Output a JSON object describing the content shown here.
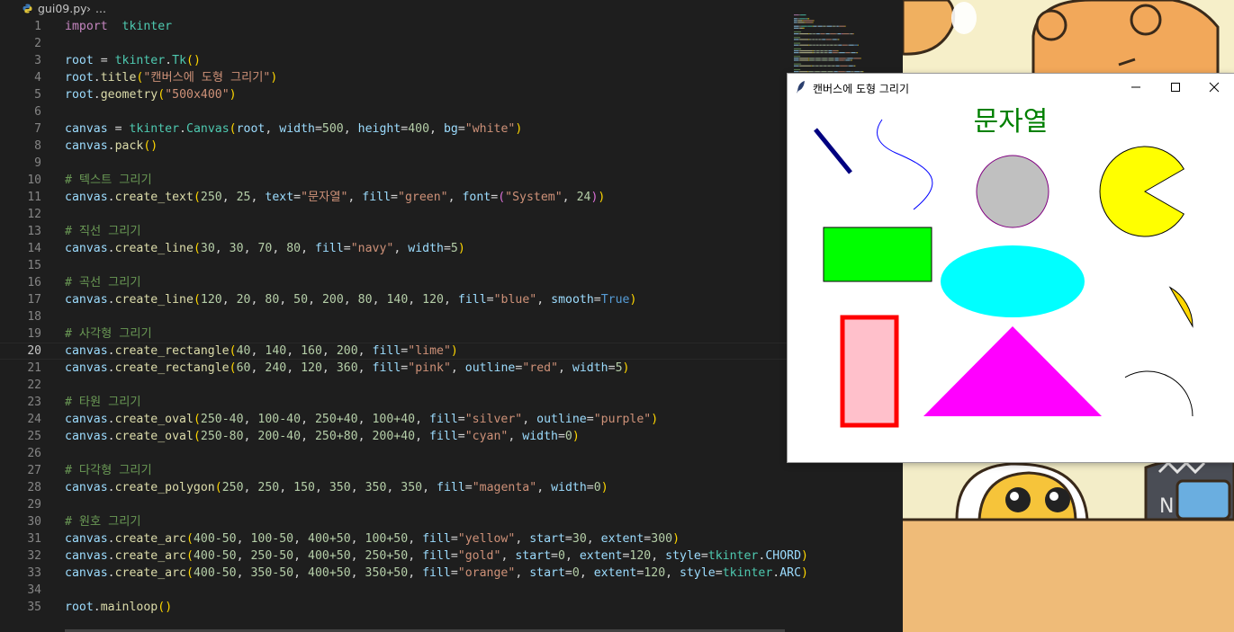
{
  "breadcrumb": {
    "file": "gui09.py",
    "separator": "›",
    "rest": "..."
  },
  "lines": [
    {
      "n": "1",
      "t": [
        [
          "kw",
          "import"
        ],
        [
          "",
          "  "
        ],
        [
          "cls",
          "tkinter"
        ]
      ]
    },
    {
      "n": "2",
      "t": []
    },
    {
      "n": "3",
      "t": [
        [
          "var",
          "root"
        ],
        [
          "",
          " = "
        ],
        [
          "cls",
          "tkinter"
        ],
        [
          "",
          "."
        ],
        [
          "cls",
          "Tk"
        ],
        [
          "p1",
          "()"
        ]
      ]
    },
    {
      "n": "4",
      "t": [
        [
          "var",
          "root"
        ],
        [
          "",
          "."
        ],
        [
          "fn",
          "title"
        ],
        [
          "p1",
          "("
        ],
        [
          "str",
          "\"캔버스에 도형 그리기\""
        ],
        [
          "p1",
          ")"
        ]
      ]
    },
    {
      "n": "5",
      "t": [
        [
          "var",
          "root"
        ],
        [
          "",
          "."
        ],
        [
          "fn",
          "geometry"
        ],
        [
          "p1",
          "("
        ],
        [
          "str",
          "\"500x400\""
        ],
        [
          "p1",
          ")"
        ]
      ]
    },
    {
      "n": "6",
      "t": []
    },
    {
      "n": "7",
      "t": [
        [
          "var",
          "canvas"
        ],
        [
          "",
          " = "
        ],
        [
          "cls",
          "tkinter"
        ],
        [
          "",
          "."
        ],
        [
          "cls",
          "Canvas"
        ],
        [
          "p1",
          "("
        ],
        [
          "var",
          "root"
        ],
        [
          "",
          ", "
        ],
        [
          "var",
          "width"
        ],
        [
          "",
          "="
        ],
        [
          "num",
          "500"
        ],
        [
          "",
          ", "
        ],
        [
          "var",
          "height"
        ],
        [
          "",
          "="
        ],
        [
          "num",
          "400"
        ],
        [
          "",
          ", "
        ],
        [
          "var",
          "bg"
        ],
        [
          "",
          "="
        ],
        [
          "str",
          "\"white\""
        ],
        [
          "p1",
          ")"
        ]
      ]
    },
    {
      "n": "8",
      "t": [
        [
          "var",
          "canvas"
        ],
        [
          "",
          "."
        ],
        [
          "fn",
          "pack"
        ],
        [
          "p1",
          "()"
        ]
      ]
    },
    {
      "n": "9",
      "t": []
    },
    {
      "n": "10",
      "t": [
        [
          "com",
          "# 텍스트 그리기"
        ]
      ]
    },
    {
      "n": "11",
      "t": [
        [
          "var",
          "canvas"
        ],
        [
          "",
          "."
        ],
        [
          "fn",
          "create_text"
        ],
        [
          "p1",
          "("
        ],
        [
          "num",
          "250"
        ],
        [
          "",
          ", "
        ],
        [
          "num",
          "25"
        ],
        [
          "",
          ", "
        ],
        [
          "var",
          "text"
        ],
        [
          "",
          "="
        ],
        [
          "str",
          "\"문자열\""
        ],
        [
          "",
          ", "
        ],
        [
          "var",
          "fill"
        ],
        [
          "",
          "="
        ],
        [
          "str",
          "\"green\""
        ],
        [
          "",
          ", "
        ],
        [
          "var",
          "font"
        ],
        [
          "",
          "="
        ],
        [
          "p2",
          "("
        ],
        [
          "str",
          "\"System\""
        ],
        [
          "",
          ", "
        ],
        [
          "num",
          "24"
        ],
        [
          "p2",
          ")"
        ],
        [
          "p1",
          ")"
        ]
      ]
    },
    {
      "n": "12",
      "t": []
    },
    {
      "n": "13",
      "t": [
        [
          "com",
          "# 직선 그리기"
        ]
      ]
    },
    {
      "n": "14",
      "t": [
        [
          "var",
          "canvas"
        ],
        [
          "",
          "."
        ],
        [
          "fn",
          "create_line"
        ],
        [
          "p1",
          "("
        ],
        [
          "num",
          "30"
        ],
        [
          "",
          ", "
        ],
        [
          "num",
          "30"
        ],
        [
          "",
          ", "
        ],
        [
          "num",
          "70"
        ],
        [
          "",
          ", "
        ],
        [
          "num",
          "80"
        ],
        [
          "",
          ", "
        ],
        [
          "var",
          "fill"
        ],
        [
          "",
          "="
        ],
        [
          "str",
          "\"navy\""
        ],
        [
          "",
          ", "
        ],
        [
          "var",
          "width"
        ],
        [
          "",
          "="
        ],
        [
          "num",
          "5"
        ],
        [
          "p1",
          ")"
        ]
      ]
    },
    {
      "n": "15",
      "t": []
    },
    {
      "n": "16",
      "t": [
        [
          "com",
          "# 곡선 그리기"
        ]
      ]
    },
    {
      "n": "17",
      "t": [
        [
          "var",
          "canvas"
        ],
        [
          "",
          "."
        ],
        [
          "fn",
          "create_line"
        ],
        [
          "p1",
          "("
        ],
        [
          "num",
          "120"
        ],
        [
          "",
          ", "
        ],
        [
          "num",
          "20"
        ],
        [
          "",
          ", "
        ],
        [
          "num",
          "80"
        ],
        [
          "",
          ", "
        ],
        [
          "num",
          "50"
        ],
        [
          "",
          ", "
        ],
        [
          "num",
          "200"
        ],
        [
          "",
          ", "
        ],
        [
          "num",
          "80"
        ],
        [
          "",
          ", "
        ],
        [
          "num",
          "140"
        ],
        [
          "",
          ", "
        ],
        [
          "num",
          "120"
        ],
        [
          "",
          ", "
        ],
        [
          "var",
          "fill"
        ],
        [
          "",
          "="
        ],
        [
          "str",
          "\"blue\""
        ],
        [
          "",
          ", "
        ],
        [
          "var",
          "smooth"
        ],
        [
          "",
          "="
        ],
        [
          "bool",
          "True"
        ],
        [
          "p1",
          ")"
        ]
      ]
    },
    {
      "n": "18",
      "t": []
    },
    {
      "n": "19",
      "t": [
        [
          "com",
          "# 사각형 그리기"
        ]
      ]
    },
    {
      "n": "20",
      "t": [
        [
          "var",
          "canvas"
        ],
        [
          "",
          "."
        ],
        [
          "fn",
          "create_rectangle"
        ],
        [
          "p1",
          "("
        ],
        [
          "num",
          "40"
        ],
        [
          "",
          ", "
        ],
        [
          "num",
          "140"
        ],
        [
          "",
          ", "
        ],
        [
          "num",
          "160"
        ],
        [
          "",
          ", "
        ],
        [
          "num",
          "200"
        ],
        [
          "",
          ", "
        ],
        [
          "var",
          "fill"
        ],
        [
          "",
          "="
        ],
        [
          "str",
          "\"lime\""
        ],
        [
          "p1",
          ")"
        ]
      ]
    },
    {
      "n": "21",
      "t": [
        [
          "var",
          "canvas"
        ],
        [
          "",
          "."
        ],
        [
          "fn",
          "create_rectangle"
        ],
        [
          "p1",
          "("
        ],
        [
          "num",
          "60"
        ],
        [
          "",
          ", "
        ],
        [
          "num",
          "240"
        ],
        [
          "",
          ", "
        ],
        [
          "num",
          "120"
        ],
        [
          "",
          ", "
        ],
        [
          "num",
          "360"
        ],
        [
          "",
          ", "
        ],
        [
          "var",
          "fill"
        ],
        [
          "",
          "="
        ],
        [
          "str",
          "\"pink\""
        ],
        [
          "",
          ", "
        ],
        [
          "var",
          "outline"
        ],
        [
          "",
          "="
        ],
        [
          "str",
          "\"red\""
        ],
        [
          "",
          ", "
        ],
        [
          "var",
          "width"
        ],
        [
          "",
          "="
        ],
        [
          "num",
          "5"
        ],
        [
          "p1",
          ")"
        ]
      ]
    },
    {
      "n": "22",
      "t": []
    },
    {
      "n": "23",
      "t": [
        [
          "com",
          "# 타원 그리기"
        ]
      ]
    },
    {
      "n": "24",
      "t": [
        [
          "var",
          "canvas"
        ],
        [
          "",
          "."
        ],
        [
          "fn",
          "create_oval"
        ],
        [
          "p1",
          "("
        ],
        [
          "num",
          "250-40"
        ],
        [
          "",
          ", "
        ],
        [
          "num",
          "100-40"
        ],
        [
          "",
          ", "
        ],
        [
          "num",
          "250+40"
        ],
        [
          "",
          ", "
        ],
        [
          "num",
          "100+40"
        ],
        [
          "",
          ", "
        ],
        [
          "var",
          "fill"
        ],
        [
          "",
          "="
        ],
        [
          "str",
          "\"silver\""
        ],
        [
          "",
          ", "
        ],
        [
          "var",
          "outline"
        ],
        [
          "",
          "="
        ],
        [
          "str",
          "\"purple\""
        ],
        [
          "p1",
          ")"
        ]
      ]
    },
    {
      "n": "25",
      "t": [
        [
          "var",
          "canvas"
        ],
        [
          "",
          "."
        ],
        [
          "fn",
          "create_oval"
        ],
        [
          "p1",
          "("
        ],
        [
          "num",
          "250-80"
        ],
        [
          "",
          ", "
        ],
        [
          "num",
          "200-40"
        ],
        [
          "",
          ", "
        ],
        [
          "num",
          "250+80"
        ],
        [
          "",
          ", "
        ],
        [
          "num",
          "200+40"
        ],
        [
          "",
          ", "
        ],
        [
          "var",
          "fill"
        ],
        [
          "",
          "="
        ],
        [
          "str",
          "\"cyan\""
        ],
        [
          "",
          ", "
        ],
        [
          "var",
          "width"
        ],
        [
          "",
          "="
        ],
        [
          "num",
          "0"
        ],
        [
          "p1",
          ")"
        ]
      ]
    },
    {
      "n": "26",
      "t": []
    },
    {
      "n": "27",
      "t": [
        [
          "com",
          "# 다각형 그리기"
        ]
      ]
    },
    {
      "n": "28",
      "t": [
        [
          "var",
          "canvas"
        ],
        [
          "",
          "."
        ],
        [
          "fn",
          "create_polygon"
        ],
        [
          "p1",
          "("
        ],
        [
          "num",
          "250"
        ],
        [
          "",
          ", "
        ],
        [
          "num",
          "250"
        ],
        [
          "",
          ", "
        ],
        [
          "num",
          "150"
        ],
        [
          "",
          ", "
        ],
        [
          "num",
          "350"
        ],
        [
          "",
          ", "
        ],
        [
          "num",
          "350"
        ],
        [
          "",
          ", "
        ],
        [
          "num",
          "350"
        ],
        [
          "",
          ", "
        ],
        [
          "var",
          "fill"
        ],
        [
          "",
          "="
        ],
        [
          "str",
          "\"magenta\""
        ],
        [
          "",
          ", "
        ],
        [
          "var",
          "width"
        ],
        [
          "",
          "="
        ],
        [
          "num",
          "0"
        ],
        [
          "p1",
          ")"
        ]
      ]
    },
    {
      "n": "29",
      "t": []
    },
    {
      "n": "30",
      "t": [
        [
          "com",
          "# 원호 그리기"
        ]
      ]
    },
    {
      "n": "31",
      "t": [
        [
          "var",
          "canvas"
        ],
        [
          "",
          "."
        ],
        [
          "fn",
          "create_arc"
        ],
        [
          "p1",
          "("
        ],
        [
          "num",
          "400-50"
        ],
        [
          "",
          ", "
        ],
        [
          "num",
          "100-50"
        ],
        [
          "",
          ", "
        ],
        [
          "num",
          "400+50"
        ],
        [
          "",
          ", "
        ],
        [
          "num",
          "100+50"
        ],
        [
          "",
          ", "
        ],
        [
          "var",
          "fill"
        ],
        [
          "",
          "="
        ],
        [
          "str",
          "\"yellow\""
        ],
        [
          "",
          ", "
        ],
        [
          "var",
          "start"
        ],
        [
          "",
          "="
        ],
        [
          "num",
          "30"
        ],
        [
          "",
          ", "
        ],
        [
          "var",
          "extent"
        ],
        [
          "",
          "="
        ],
        [
          "num",
          "300"
        ],
        [
          "p1",
          ")"
        ]
      ]
    },
    {
      "n": "32",
      "t": [
        [
          "var",
          "canvas"
        ],
        [
          "",
          "."
        ],
        [
          "fn",
          "create_arc"
        ],
        [
          "p1",
          "("
        ],
        [
          "num",
          "400-50"
        ],
        [
          "",
          ", "
        ],
        [
          "num",
          "250-50"
        ],
        [
          "",
          ", "
        ],
        [
          "num",
          "400+50"
        ],
        [
          "",
          ", "
        ],
        [
          "num",
          "250+50"
        ],
        [
          "",
          ", "
        ],
        [
          "var",
          "fill"
        ],
        [
          "",
          "="
        ],
        [
          "str",
          "\"gold\""
        ],
        [
          "",
          ", "
        ],
        [
          "var",
          "start"
        ],
        [
          "",
          "="
        ],
        [
          "num",
          "0"
        ],
        [
          "",
          ", "
        ],
        [
          "var",
          "extent"
        ],
        [
          "",
          "="
        ],
        [
          "num",
          "120"
        ],
        [
          "",
          ", "
        ],
        [
          "var",
          "style"
        ],
        [
          "",
          "="
        ],
        [
          "cls",
          "tkinter"
        ],
        [
          "",
          "."
        ],
        [
          "var",
          "CHORD"
        ],
        [
          "p1",
          ")"
        ]
      ]
    },
    {
      "n": "33",
      "t": [
        [
          "var",
          "canvas"
        ],
        [
          "",
          "."
        ],
        [
          "fn",
          "create_arc"
        ],
        [
          "p1",
          "("
        ],
        [
          "num",
          "400-50"
        ],
        [
          "",
          ", "
        ],
        [
          "num",
          "350-50"
        ],
        [
          "",
          ", "
        ],
        [
          "num",
          "400+50"
        ],
        [
          "",
          ", "
        ],
        [
          "num",
          "350+50"
        ],
        [
          "",
          ", "
        ],
        [
          "var",
          "fill"
        ],
        [
          "",
          "="
        ],
        [
          "str",
          "\"orange\""
        ],
        [
          "",
          ", "
        ],
        [
          "var",
          "start"
        ],
        [
          "",
          "="
        ],
        [
          "num",
          "0"
        ],
        [
          "",
          ", "
        ],
        [
          "var",
          "extent"
        ],
        [
          "",
          "="
        ],
        [
          "num",
          "120"
        ],
        [
          "",
          ", "
        ],
        [
          "var",
          "style"
        ],
        [
          "",
          "="
        ],
        [
          "cls",
          "tkinter"
        ],
        [
          "",
          "."
        ],
        [
          "var",
          "ARC"
        ],
        [
          "p1",
          ")"
        ]
      ]
    },
    {
      "n": "34",
      "t": []
    },
    {
      "n": "35",
      "t": [
        [
          "var",
          "root"
        ],
        [
          "",
          "."
        ],
        [
          "fn",
          "mainloop"
        ],
        [
          "p1",
          "()"
        ]
      ]
    }
  ],
  "current_line": "20",
  "window": {
    "title": "캔버스에 도형 그리기"
  },
  "canvas_text": {
    "text": "문자열",
    "color": "#008000"
  },
  "colors": {
    "navy": "#000080",
    "blue": "#0000ff",
    "lime": "#00ff00",
    "pink": "#ffc0cb",
    "red": "#ff0000",
    "silver": "#c0c0c0",
    "purple": "#800080",
    "cyan": "#00ffff",
    "magenta": "#ff00ff",
    "yellow": "#ffff00",
    "gold": "#ffd700",
    "orange": "#ffa500"
  }
}
